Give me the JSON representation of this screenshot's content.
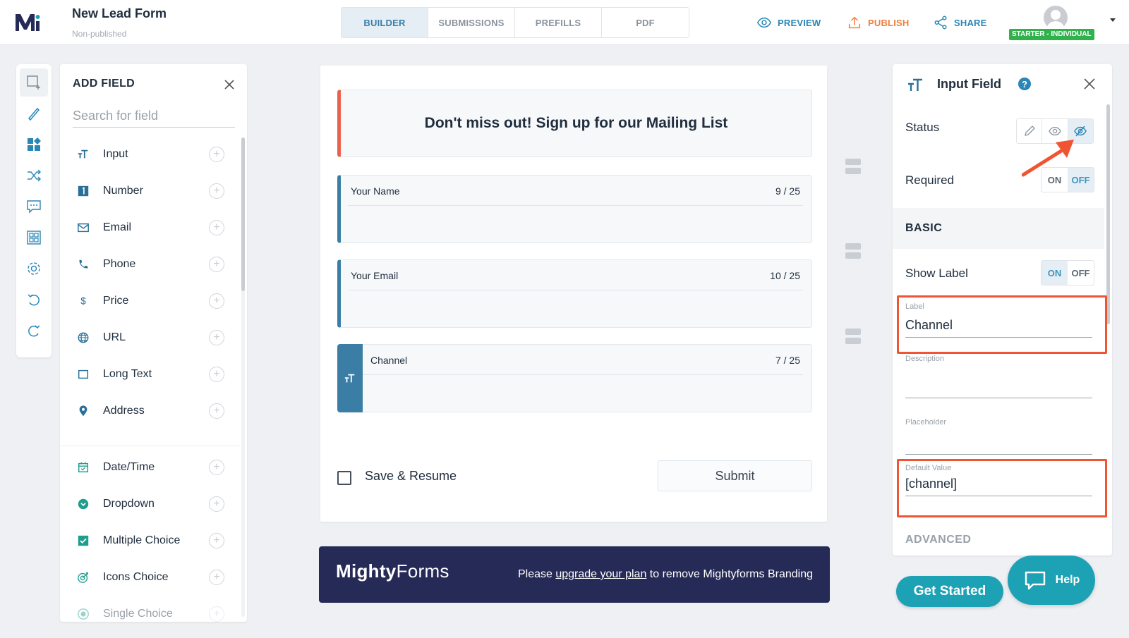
{
  "header": {
    "form_title": "New Lead Form",
    "form_status": "Non-published",
    "tabs": [
      {
        "label": "BUILDER",
        "active": true
      },
      {
        "label": "SUBMISSIONS",
        "active": false
      },
      {
        "label": "PREFILLS",
        "active": false
      },
      {
        "label": "PDF",
        "active": false
      }
    ],
    "actions": {
      "preview": "PREVIEW",
      "publish": "PUBLISH",
      "share": "SHARE"
    },
    "plan_badge": "STARTER - INDIVIDUAL"
  },
  "rail": {
    "icons": [
      "add-field-icon",
      "brush-icon",
      "widgets-icon",
      "shuffle-icon",
      "messages-icon",
      "templates-icon",
      "settings-icon",
      "undo-icon",
      "redo-icon"
    ]
  },
  "add_field": {
    "title": "ADD FIELD",
    "search_placeholder": "Search for field",
    "items": [
      {
        "label": "Input",
        "icon": "text-input-icon"
      },
      {
        "label": "Number",
        "icon": "number-icon"
      },
      {
        "label": "Email",
        "icon": "email-icon"
      },
      {
        "label": "Phone",
        "icon": "phone-icon"
      },
      {
        "label": "Price",
        "icon": "dollar-icon"
      },
      {
        "label": "URL",
        "icon": "globe-icon"
      },
      {
        "label": "Long Text",
        "icon": "long-text-icon"
      },
      {
        "label": "Address",
        "icon": "map-pin-icon"
      },
      {
        "label": "Date/Time",
        "icon": "calendar-icon"
      },
      {
        "label": "Dropdown",
        "icon": "dropdown-icon"
      },
      {
        "label": "Multiple Choice",
        "icon": "checkbox-icon"
      },
      {
        "label": "Icons Choice",
        "icon": "target-icon"
      },
      {
        "label": "Single Choice",
        "icon": "radio-icon"
      }
    ]
  },
  "canvas": {
    "heading": "Don't miss out! Sign up for our Mailing List",
    "fields": [
      {
        "label": "Your Name",
        "count": "9 / 25"
      },
      {
        "label": "Your Email",
        "count": "10 / 25"
      },
      {
        "label": "Channel",
        "count": "7 / 25"
      }
    ],
    "save_resume": "Save & Resume",
    "submit": "Submit"
  },
  "branding": {
    "logo_bold": "Mighty",
    "logo_light": "Forms",
    "text_before": "Please",
    "link_text": "upgrade your plan",
    "text_after": "to remove Mightyforms Branding"
  },
  "properties": {
    "title": "Input Field",
    "help_glyph": "?",
    "status_label": "Status",
    "required_label": "Required",
    "required_on": "ON",
    "required_off": "OFF",
    "basic_label": "BASIC",
    "show_label": "Show Label",
    "show_label_on": "ON",
    "show_label_off": "OFF",
    "label_caption": "Label",
    "label_value": "Channel",
    "description_caption": "Description",
    "placeholder_caption": "Placeholder",
    "default_value_caption": "Default Value",
    "default_value": "[channel]",
    "advanced_label": "ADVANCED"
  },
  "footer": {
    "get_started": "Get Started",
    "help": "Help"
  },
  "colors": {
    "accent": "#3a7ea6",
    "brand_navy": "#262a56",
    "teal": "#1da1b5",
    "highlight": "#f05432",
    "publish": "#f07d3c",
    "badge": "#2fb24c"
  }
}
